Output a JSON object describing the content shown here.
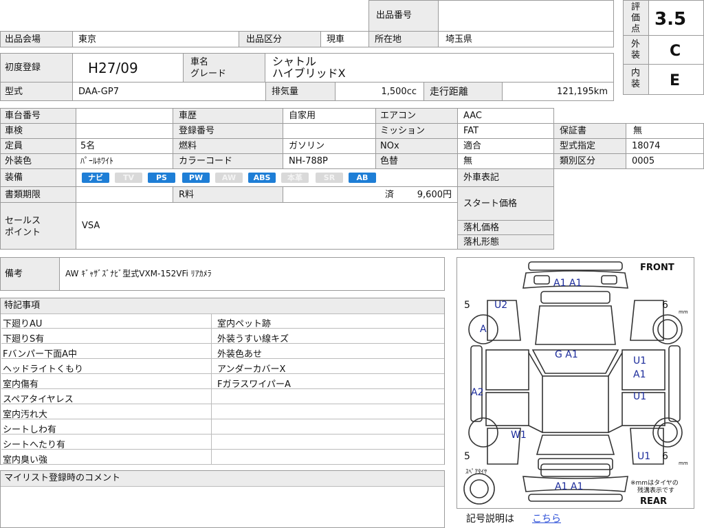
{
  "header": {
    "lot_label": "出品番号",
    "lot_value": "",
    "venue_label": "出品会場",
    "venue_value": "東京",
    "category_label": "出品区分",
    "category_value": "現車",
    "location_label": "所在地",
    "location_value": "埼玉県"
  },
  "scores": {
    "overall_label": "評価点",
    "overall_value": "3.5",
    "exterior_label": "外装",
    "exterior_value": "C",
    "interior_label": "内装",
    "interior_value": "E"
  },
  "vehicle": {
    "first_reg_label": "初度登録",
    "first_reg_value": "H27/09",
    "name_label": "車名",
    "grade_label": "グレード",
    "name_value": "シャトル",
    "grade_value": "ハイブリッドX",
    "model_label": "型式",
    "model_value": "DAA-GP7",
    "displacement_label": "排気量",
    "displacement_value": "1,500cc",
    "mileage_label": "走行距離",
    "mileage_value": "121,195km"
  },
  "specs": {
    "chassis_label": "車台番号",
    "chassis_value": "",
    "history_label": "車歴",
    "history_value": "自家用",
    "ac_label": "エアコン",
    "ac_value": "AAC",
    "inspection_label": "車検",
    "inspection_value": "",
    "regno_label": "登録番号",
    "regno_value": "",
    "transmission_label": "ミッション",
    "transmission_value": "FAT",
    "warranty_label": "保証書",
    "warranty_value": "無",
    "capacity_label": "定員",
    "capacity_value": "5名",
    "fuel_label": "燃料",
    "fuel_value": "ガソリン",
    "nox_label": "NOx",
    "nox_value": "適合",
    "model_designation_label": "型式指定",
    "model_designation_value": "18074",
    "color_label": "外装色",
    "color_value": "ﾊﾟｰﾙﾎﾜｲﾄ",
    "colorcode_label": "カラーコード",
    "colorcode_value": "NH-788P",
    "colorchange_label": "色替",
    "colorchange_value": "無",
    "class_label": "類別区分",
    "class_value": "0005",
    "equipment_label": "装備",
    "docs_label": "書類期限",
    "docs_value": "",
    "recycle_label": "R料",
    "recycle_status": "済",
    "recycle_value": "9,600円",
    "exterior_record_label": "外車表記",
    "start_price_label": "スタート価格",
    "sale_price_label": "落札価格",
    "sale_type_label": "落札形態",
    "sales_point_label": "セールスポイント",
    "sales_point_line1": "セールス",
    "sales_point_line2": "ポイント",
    "sales_point_value": "VSA"
  },
  "equipment_badges": [
    {
      "label": "ナビ",
      "on": true
    },
    {
      "label": "TV",
      "on": false
    },
    {
      "label": "PS",
      "on": true
    },
    {
      "label": "PW",
      "on": true
    },
    {
      "label": "AW",
      "on": false
    },
    {
      "label": "ABS",
      "on": true
    },
    {
      "label": "本革",
      "on": false
    },
    {
      "label": "SR",
      "on": false
    },
    {
      "label": "AB",
      "on": true
    }
  ],
  "notes": {
    "label": "備考",
    "value": "AW ｷﾞｬｻﾞｽﾞﾅﾋﾞ型式VXM-152VFi ﾘｱｶﾒﾗ"
  },
  "special": {
    "title": "特記事項",
    "left": [
      "下廻りAU",
      "下廻りS有",
      "Fバンパー下面A中",
      "ヘッドライトくもり",
      "室内傷有",
      "スペアタイヤレス",
      "室内汚れ大",
      "シートしわ有",
      "シートへたり有",
      "室内臭い強"
    ],
    "right": [
      "室内ペット跡",
      "外装うすい線キズ",
      "外装色あせ",
      "アンダーカバーX",
      "FガラスワイパーA"
    ]
  },
  "mylist": {
    "title": "マイリスト登録時のコメント"
  },
  "diagram": {
    "front_label": "FRONT",
    "rear_label": "REAR",
    "tire_note_line1": "※mmはタイヤの",
    "tire_note_line2": "残溝表示です",
    "spare_label": "ｽﾍﾟｱﾀｲﾔ",
    "mm_unit": "mm",
    "tire_fl": "5",
    "tire_fr": "6",
    "tire_rl": "5",
    "tire_rr": "6",
    "marks": {
      "front_bumper": "A1  A1",
      "front_left_fender": "U2",
      "front_left_tire": "A",
      "windshield": "G  A1",
      "left_side": "A2",
      "right_front_door": "U1",
      "right_front_door2": "A1",
      "right_rear_door": "U1",
      "left_rear": "W1",
      "right_rear_fender": "U1",
      "rear_bumper": "A1  A1"
    },
    "legend_label": "記号説明は",
    "legend_link": "こちら"
  }
}
